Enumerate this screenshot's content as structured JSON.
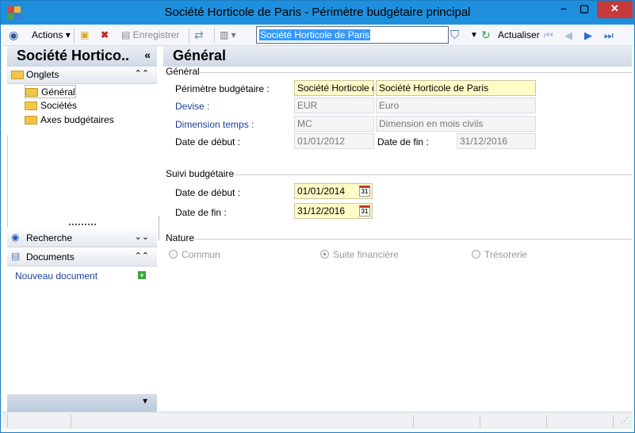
{
  "window": {
    "title": "Société Horticole de Paris -  Périmètre budgétaire principal"
  },
  "toolbar": {
    "actions_label": "Actions",
    "save_label": "Enregistrer",
    "search_value": "Société Horticole de Paris",
    "refresh_label": "Actualiser"
  },
  "left": {
    "header": "Société Hortico..",
    "tabs_section": "Onglets",
    "tree": [
      "Général",
      "Sociétés",
      "Axes budgétaires"
    ],
    "search_section": "Recherche",
    "documents_section": "Documents",
    "new_document": "Nouveau document"
  },
  "main": {
    "header": "Général",
    "general": {
      "title": "Général",
      "perimetre_label": "Périmètre budgétaire :",
      "perimetre_code": "Société Horticole d",
      "perimetre_name": "Société Horticole de Paris",
      "devise_label": "Devise :",
      "devise_code": "EUR",
      "devise_name": "Euro",
      "dimension_label": "Dimension temps :",
      "dimension_code": "MC",
      "dimension_name": "Dimension en mois civils",
      "start_label": "Date de début :",
      "start_value": "01/01/2012",
      "end_label": "Date de fin :",
      "end_value": "31/12/2016"
    },
    "suivi": {
      "title": "Suivi budgétaire",
      "start_label": "Date de début :",
      "start_value": "01/01/2014",
      "end_label": "Date de fin :",
      "end_value": "31/12/2016",
      "cal_glyph": "31"
    },
    "nature": {
      "title": "Nature",
      "options": [
        "Commun",
        "Suite financière",
        "Trésorerie"
      ],
      "selected": "Suite financière"
    }
  },
  "colors": {
    "titlebar": "#1e8fdc",
    "close": "#c7393a",
    "edit_field": "#fffbc6",
    "link": "#1b3f9a"
  }
}
